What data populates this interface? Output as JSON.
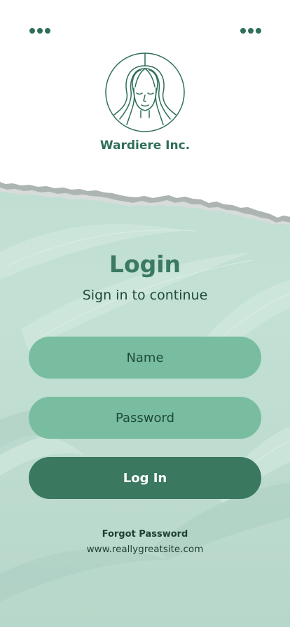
{
  "header": {
    "company_name": "Wardiere Inc.",
    "logo_icon": "woman-face-circle-logo"
  },
  "menu": {
    "left_icon": "more-dots-icon",
    "right_icon": "more-dots-icon"
  },
  "login": {
    "title": "Login",
    "subtitle": "Sign in to continue",
    "name_placeholder": "Name",
    "password_placeholder": "Password",
    "login_label": "Log In",
    "forgot_label": "Forgot Password",
    "website": "www.reallygreatsite.com"
  },
  "colors": {
    "brand": "#2f6f57",
    "field": "#79bda1",
    "button": "#3a7860",
    "background": "#bfddd1"
  }
}
